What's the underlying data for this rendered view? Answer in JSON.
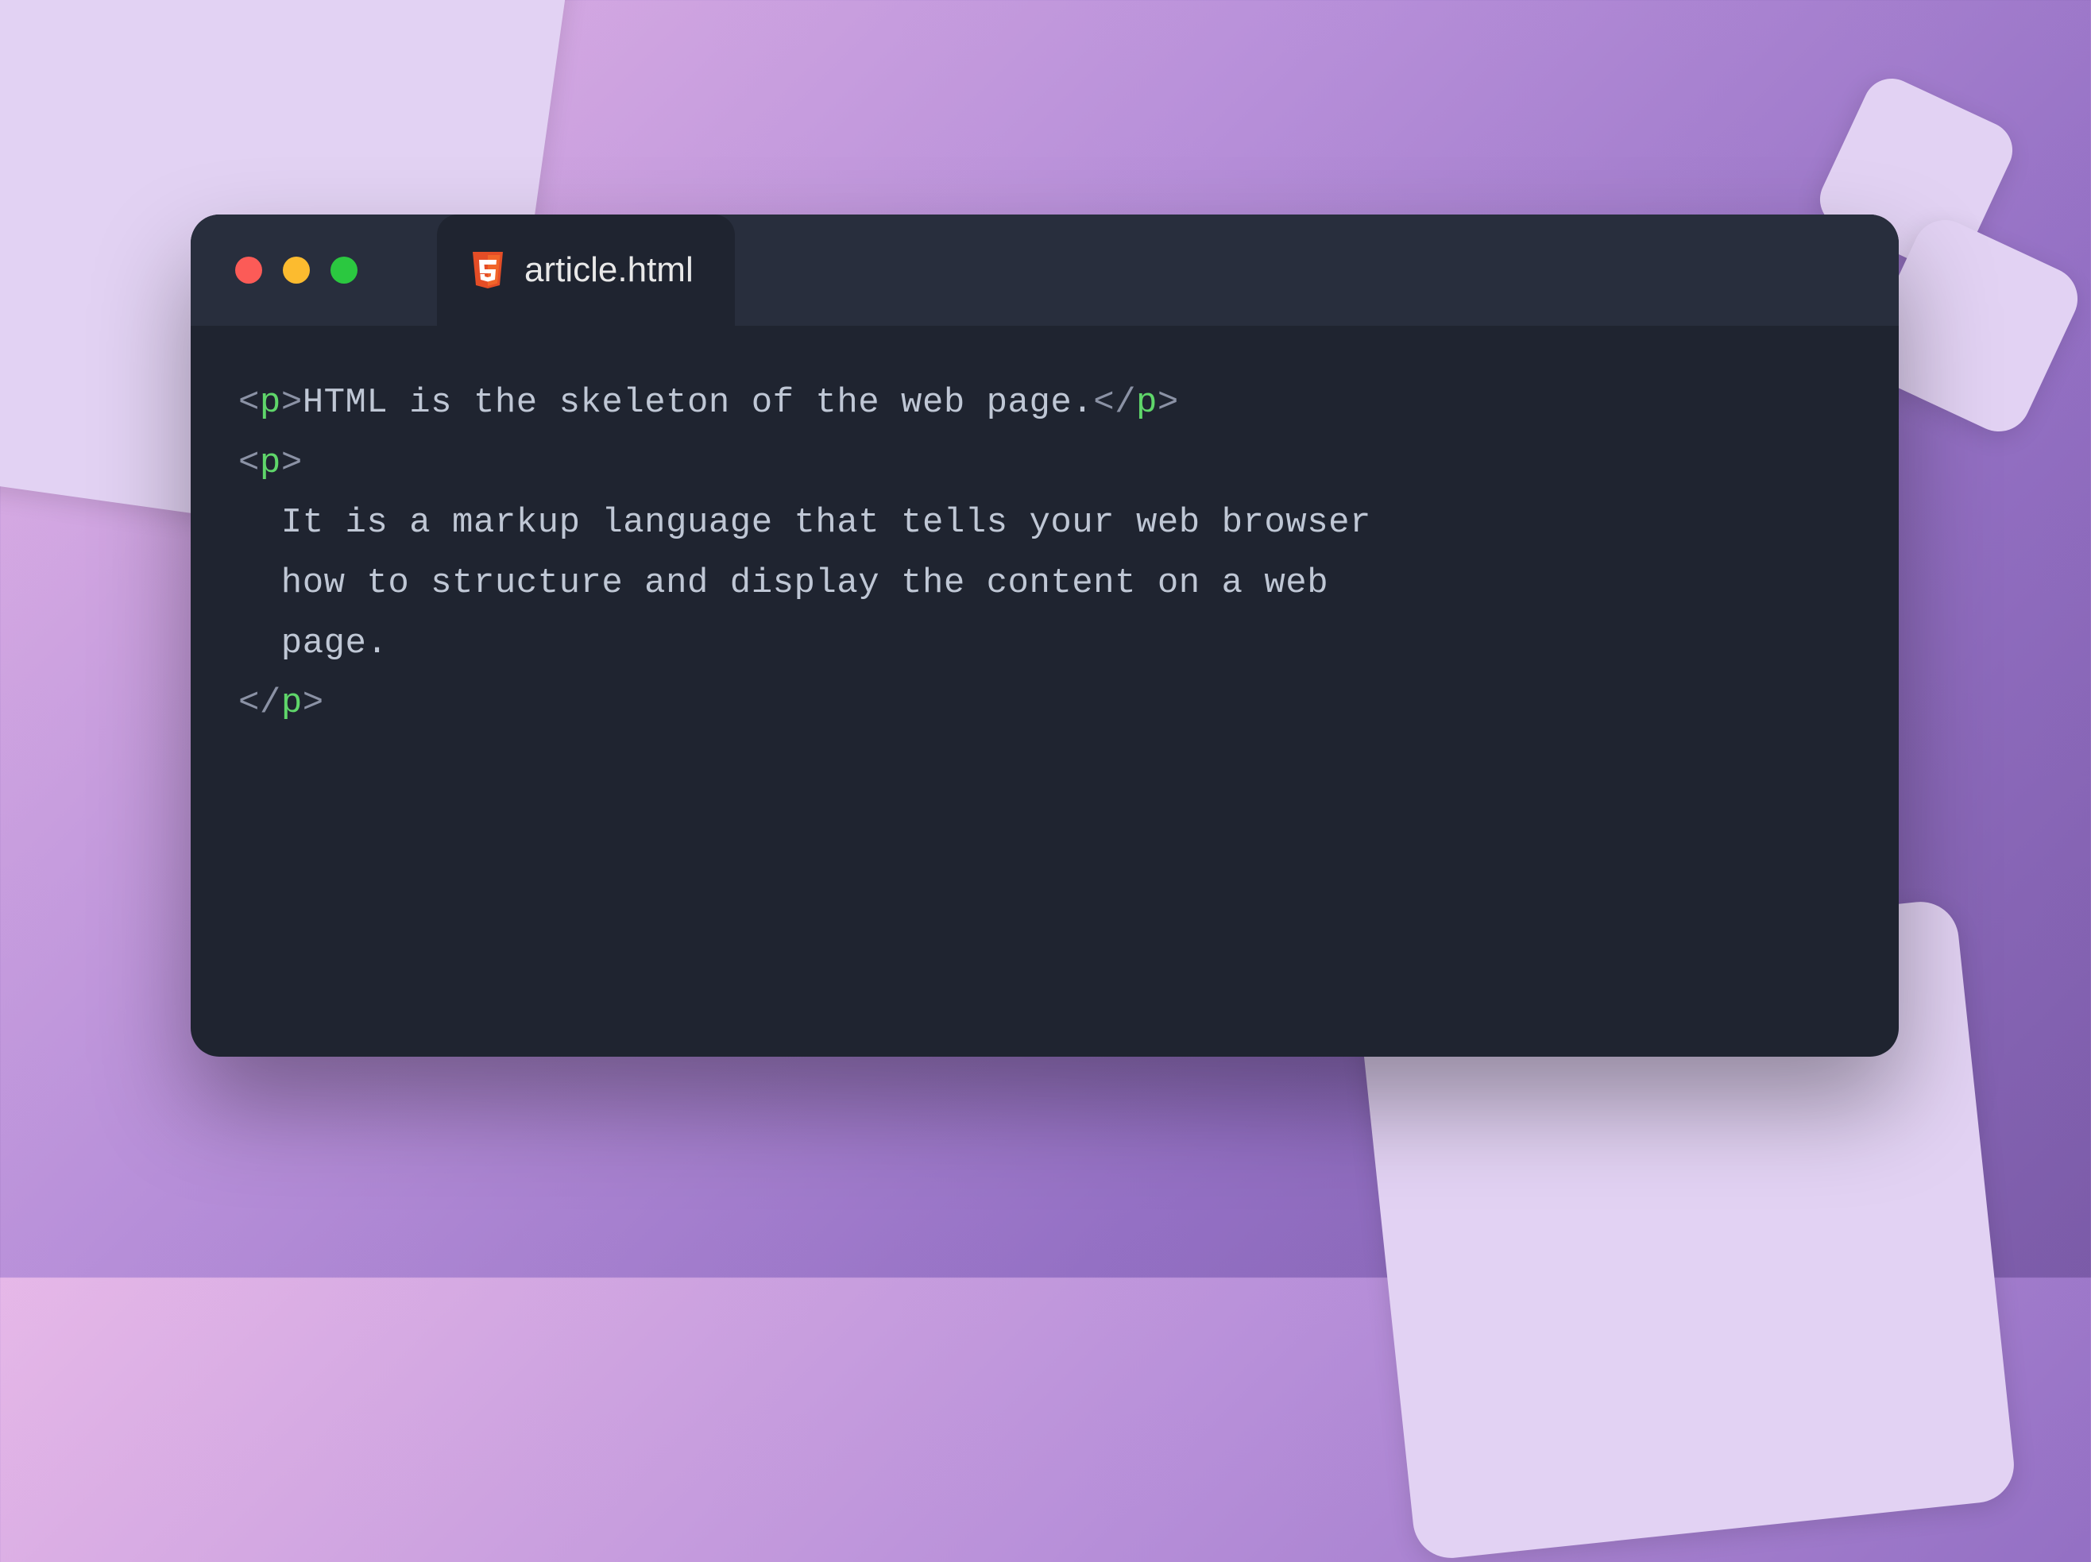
{
  "tab": {
    "filename": "article.html"
  },
  "traffic_light_colors": {
    "close": "#fc5b57",
    "minimize": "#fcbb2f",
    "maximize": "#2bc840"
  },
  "syntax_colors": {
    "bracket": "#8b92a5",
    "tag": "#5fd66a",
    "text": "#bfc7d5"
  },
  "code": {
    "tokens": [
      [
        {
          "t": "br",
          "v": "<"
        },
        {
          "t": "tag",
          "v": "p"
        },
        {
          "t": "br",
          "v": ">"
        },
        {
          "t": "txt",
          "v": "HTML is the skeleton of the web page."
        },
        {
          "t": "br",
          "v": "</"
        },
        {
          "t": "tag",
          "v": "p"
        },
        {
          "t": "br",
          "v": ">"
        }
      ],
      [
        {
          "t": "br",
          "v": "<"
        },
        {
          "t": "tag",
          "v": "p"
        },
        {
          "t": "br",
          "v": ">"
        }
      ],
      [
        {
          "t": "txt",
          "v": "  It is a markup language that tells your web browser"
        }
      ],
      [
        {
          "t": "txt",
          "v": "  how to structure and display the content on a web"
        }
      ],
      [
        {
          "t": "txt",
          "v": "  page."
        }
      ],
      [
        {
          "t": "br",
          "v": "</"
        },
        {
          "t": "tag",
          "v": "p"
        },
        {
          "t": "br",
          "v": ">"
        }
      ]
    ]
  }
}
